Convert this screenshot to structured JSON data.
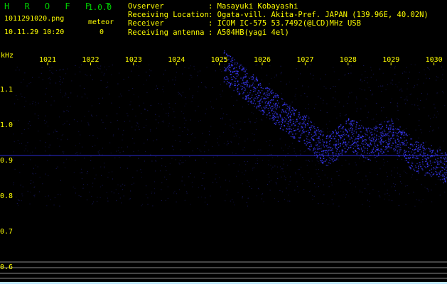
{
  "header": {
    "app_title": "H R O F F T",
    "version": "1.0.0",
    "filename": "1011291020.png",
    "meteor_label": "meteor",
    "timestamp": "10.11.29 10:20",
    "meteor_count": "0"
  },
  "station": [
    {
      "key": "Ovserver",
      "value": ": Masayuki Kobayashi"
    },
    {
      "key": "Receiving Location",
      "value": ": Ogata-vill. Akita-Pref. JAPAN (139.96E, 40.02N)"
    },
    {
      "key": "Receiver",
      "value": ": ICOM IC-575 53.7492(@LCD)MHz USB"
    },
    {
      "key": "Receiving antenna",
      "value": ": A504HB(yagi 4el)"
    }
  ],
  "chart_data": {
    "type": "heatmap",
    "xlabel": "",
    "ylabel": "kHz",
    "x_ticks": [
      "1021",
      "1022",
      "1023",
      "1024",
      "1025",
      "1026",
      "1027",
      "1028",
      "1029",
      "1030"
    ],
    "y_ticks": [
      "1.1",
      "1.0",
      "0.9",
      "0.8",
      "0.7",
      "0.6"
    ],
    "signal_trace": [
      {
        "x": 1025.1,
        "y": 1.17
      },
      {
        "x": 1025.5,
        "y": 1.13
      },
      {
        "x": 1026.0,
        "y": 1.08
      },
      {
        "x": 1026.5,
        "y": 1.03
      },
      {
        "x": 1027.0,
        "y": 0.99
      },
      {
        "x": 1027.5,
        "y": 0.93
      },
      {
        "x": 1028.0,
        "y": 0.98
      },
      {
        "x": 1028.5,
        "y": 0.95
      },
      {
        "x": 1029.0,
        "y": 0.98
      },
      {
        "x": 1029.5,
        "y": 0.92
      },
      {
        "x": 1030.0,
        "y": 0.9
      },
      {
        "x": 1030.3,
        "y": 0.88
      }
    ],
    "reference_line_khz": 0.918,
    "colors": {
      "background": "#000000",
      "signal": "#3a3aff",
      "axis_text": "#ffff00",
      "grid_text": "#ffff00"
    }
  }
}
